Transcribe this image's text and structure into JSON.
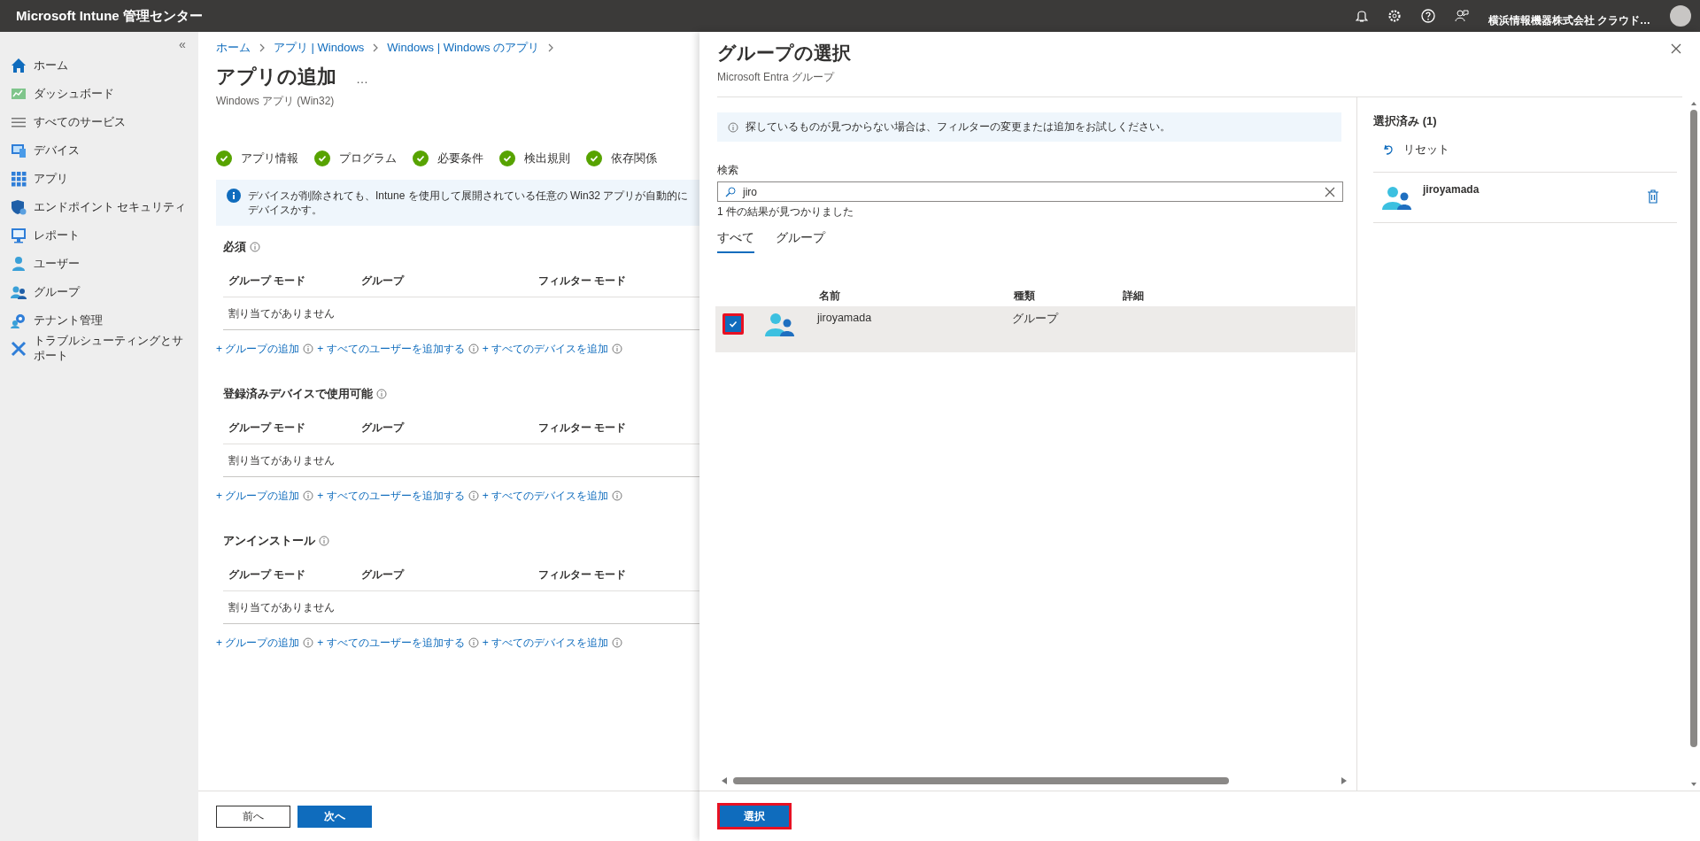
{
  "top_bar": {
    "title": "Microsoft Intune 管理センター",
    "account": "横浜情報機器株式会社 クラウド…"
  },
  "sidebar": {
    "collapse": "«",
    "items": [
      {
        "label": "ホーム",
        "kind": "home"
      },
      {
        "label": "ダッシュボード",
        "kind": "dashboard"
      },
      {
        "label": "すべてのサービス",
        "kind": "list"
      },
      {
        "label": "デバイス",
        "kind": "device"
      },
      {
        "label": "アプリ",
        "kind": "apps"
      },
      {
        "label": "エンドポイント セキュリティ",
        "kind": "shield"
      },
      {
        "label": "レポート",
        "kind": "report"
      },
      {
        "label": "ユーザー",
        "kind": "user"
      },
      {
        "label": "グループ",
        "kind": "group"
      },
      {
        "label": "テナント管理",
        "kind": "tenant"
      },
      {
        "label": "トラブルシューティングとサポート",
        "kind": "tools"
      }
    ]
  },
  "main": {
    "breadcrumbs": [
      "ホーム",
      "アプリ | Windows",
      "Windows | Windows のアプリ"
    ],
    "title": "アプリの追加",
    "more": "…",
    "subtitle": "Windows アプリ (Win32)",
    "steps": [
      {
        "label": "アプリ情報",
        "done": true
      },
      {
        "label": "プログラム",
        "done": true
      },
      {
        "label": "必要条件",
        "done": true
      },
      {
        "label": "検出規則",
        "done": true
      },
      {
        "label": "依存関係",
        "done": true
      }
    ],
    "info": "デバイスが削除されても、Intune を使用して展開されている任意の Win32 アプリが自動的にデバイスかす。",
    "sections": [
      {
        "title": "必須",
        "columns": [
          "グループ モード",
          "グループ",
          "フィルター モード"
        ],
        "empty": "割り当てがありません",
        "links": [
          "+ グループの追加",
          "+ すべてのユーザーを追加する",
          "+ すべてのデバイスを追加"
        ]
      },
      {
        "title": "登録済みデバイスで使用可能",
        "columns": [
          "グループ モード",
          "グループ",
          "フィルター モード"
        ],
        "empty": "割り当てがありません",
        "links": [
          "+ グループの追加",
          "+ すべてのユーザーを追加する",
          "+ すべてのデバイスを追加"
        ]
      },
      {
        "title": "アンインストール",
        "columns": [
          "グループ モード",
          "グループ",
          "フィルター モード"
        ],
        "empty": "割り当てがありません",
        "links": [
          "+ グループの追加",
          "+ すべてのユーザーを追加する",
          "+ すべてのデバイスを追加"
        ]
      }
    ],
    "buttons": [
      {
        "label": "前へ",
        "kind": "secondary"
      },
      {
        "label": "次へ",
        "kind": "primary"
      }
    ]
  },
  "panel": {
    "title": "グループの選択",
    "subtitle": "Microsoft Entra グループ",
    "info": "探しているものが見つからない場合は、フィルターの変更または追加をお試しください。",
    "search": {
      "label": "検索",
      "value": "jiro"
    },
    "result_count": "1 件の結果が見つかりました",
    "tabs": [
      {
        "label": "すべて",
        "selected": true
      },
      {
        "label": "グループ",
        "selected": false
      }
    ],
    "table": {
      "columns": [
        "名前",
        "種類",
        "詳細"
      ],
      "rows": [
        {
          "name": "jiroyamada",
          "type": "グループ",
          "checked": true,
          "highlighted": true
        }
      ]
    },
    "selected_pane": {
      "title": "選択済み",
      "count": "(1)",
      "reset": "リセット",
      "items": [
        {
          "name": "jiroyamada"
        }
      ]
    },
    "select_button": {
      "label": "選択",
      "highlighted": true
    }
  }
}
